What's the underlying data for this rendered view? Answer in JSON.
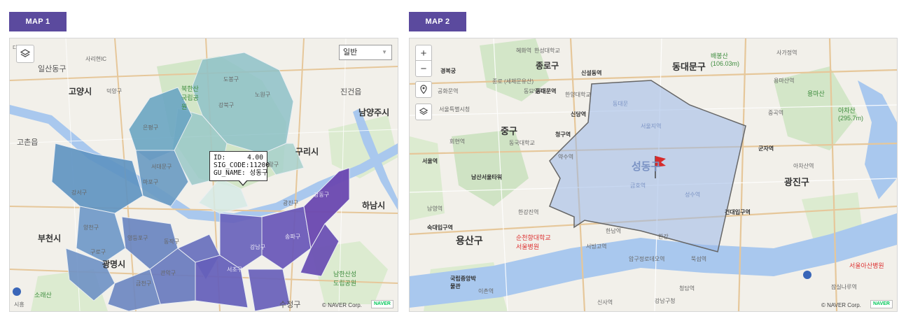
{
  "map1": {
    "tag_label": "MAP 1",
    "maptype_select": {
      "value": "일반"
    },
    "tooltip": {
      "id_label": "ID:",
      "id_value": "4.00",
      "sig_label": "SIG_CODE:",
      "sig_value": "11200",
      "gu_label": "GU_NAME:",
      "gu_value": "성동구"
    },
    "place_labels": [
      "다리",
      "일산동구",
      "사리현IC",
      "고양시",
      "덕양구",
      "북한산 국립공원",
      "도봉구",
      "노원구",
      "진건읍",
      "강북구",
      "남양주시",
      "은평구",
      "구리시",
      "서대문구",
      "고촌읍",
      "강서구",
      "마포구",
      "중랑구",
      "양천구",
      "영등포구",
      "동작구",
      "광진구",
      "강동구",
      "하남시",
      "부천시",
      "광명시",
      "관악구",
      "서초구",
      "강남구",
      "송파구",
      "구로구",
      "금천구",
      "소래산",
      "수정구",
      "남한산성 도립공원",
      "시흥"
    ],
    "copyright": "© NAVER Corp.",
    "naver_badge": "NAVER",
    "icons": [
      "layers-icon",
      "chevron-down-icon"
    ]
  },
  "map2": {
    "tag_label": "MAP 2",
    "place_labels": [
      "동대문구",
      "배봉산 (106.03m)",
      "경복궁",
      "혜화역",
      "한성대학교",
      "종로 (세체문유산)",
      "종로구",
      "신설동역",
      "사가정역",
      "동묘앞역",
      "용마산역",
      "공화문역",
      "동대문역",
      "한양대학교",
      "용마산",
      "신당역",
      "서울특별시청",
      "중구",
      "청구역",
      "중곡역",
      "아차산 (295.7m)",
      "회현역",
      "동국대학교",
      "약수역",
      "군자역",
      "서울역",
      "남산서울타워",
      "성동구",
      "아차산역",
      "광진구",
      "남영역",
      "한강진역",
      "건대입구역",
      "용산구",
      "숙대입구역",
      "순천향대학교 서울병원",
      "서빙고역",
      "한남역",
      "압구정로데오역",
      "뚝섬역",
      "국립중앙박물관",
      "이촌역",
      "신사역",
      "청담역",
      "강남구청",
      "서울아산병원",
      "잠실나루역",
      "서울지역",
      "금호역",
      "성수역",
      "동대문",
      "한강"
    ],
    "zoom_in_label": "+",
    "zoom_out_label": "−",
    "copyright": "© NAVER Corp.",
    "naver_badge": "NAVER",
    "icons": [
      "zoom-in-icon",
      "zoom-out-icon",
      "location-pin-icon",
      "layers-icon",
      "red-flag-icon"
    ]
  },
  "colors": {
    "tag_bg": "#5b4a9e",
    "choropleth_low": "#b9dcd9",
    "choropleth_mid": "#5a88b8",
    "choropleth_high": "#6a4bb0",
    "selection_fill": "#9ab8e8",
    "river": "#a9c8ee",
    "park": "#cfe3c4"
  }
}
